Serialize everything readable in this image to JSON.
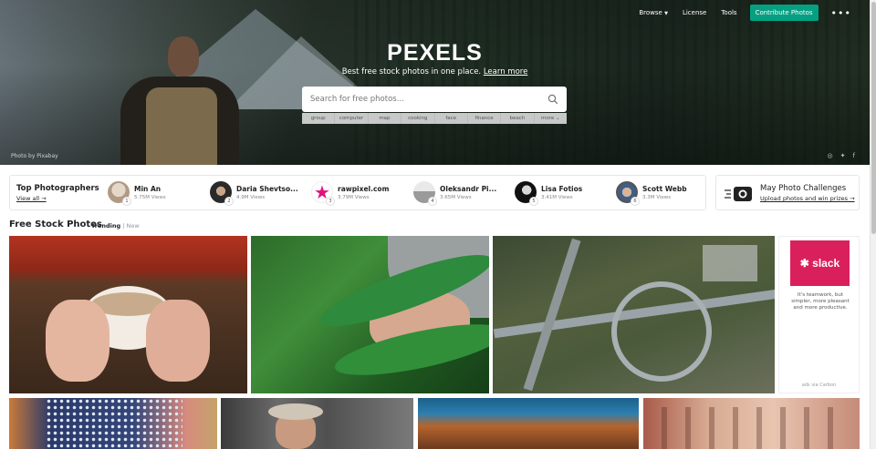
{
  "hero": {
    "brand": "PEXELS",
    "tagline": "Best free stock photos in one place.",
    "tagline_link": "Learn more",
    "credit": "Photo by Pixabay"
  },
  "nav": {
    "browse": "Browse",
    "license": "License",
    "tools": "Tools",
    "contribute": "Contribute Photos",
    "more": "•••"
  },
  "search": {
    "placeholder": "Search for free photos...",
    "tags": [
      "group",
      "computer",
      "map",
      "cooking",
      "face",
      "finance",
      "beach",
      "more ⌄"
    ]
  },
  "photographers": {
    "title": "Top Photographers",
    "view_all": "View all →",
    "items": [
      {
        "rank": "1",
        "name": "Min An",
        "views": "5.75M Views",
        "color": "#c9b9a8"
      },
      {
        "rank": "2",
        "name": "Daria Shevtso...",
        "views": "4.9M Views",
        "color": "#2a2a2a"
      },
      {
        "rank": "3",
        "name": "rawpixel.com",
        "views": "3.79M Views",
        "color": "#e2117c"
      },
      {
        "rank": "4",
        "name": "Oleksandr Pi...",
        "views": "3.65M Views",
        "color": "#8a8a8a"
      },
      {
        "rank": "5",
        "name": "Lisa Fotios",
        "views": "3.41M Views",
        "color": "#111111"
      },
      {
        "rank": "6",
        "name": "Scott Webb",
        "views": "3.3M Views",
        "color": "#555555"
      }
    ]
  },
  "challenge": {
    "title": "May Photo Challenges",
    "subtitle": "Upload photos and win prizes →"
  },
  "section": {
    "title": "Free Stock Photos",
    "tab_trending": "Trending",
    "separator": "|",
    "tab_new": "New"
  },
  "ad": {
    "brand": "✱ slack",
    "copy": "It's teamwork, but simpler, more pleasant and more productive.",
    "via": "ads via Carbon"
  },
  "colors": {
    "accent": "#05a081",
    "ad_brand": "#d9205d"
  }
}
